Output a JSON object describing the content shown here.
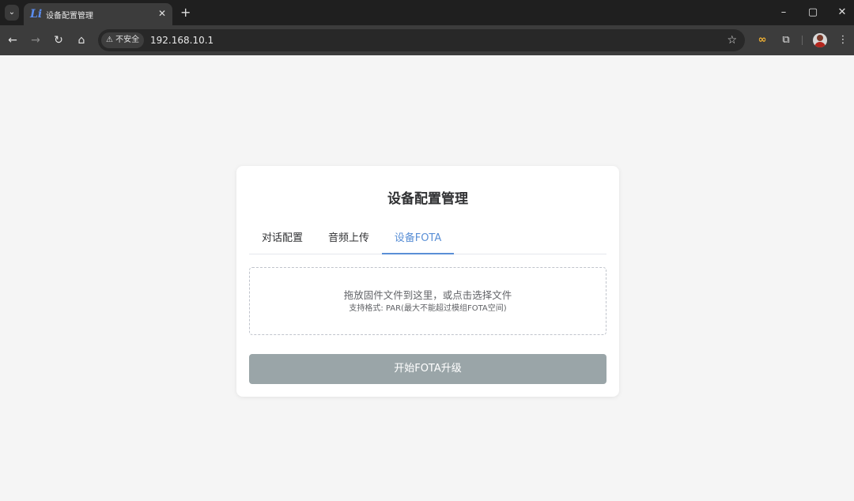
{
  "browser": {
    "tab": {
      "favicon_text": "Li",
      "title": "设备配置管理",
      "close_glyph": "✕"
    },
    "new_tab_glyph": "+",
    "window_controls": {
      "minimize": "–",
      "maximize": "▢",
      "close": "✕"
    },
    "nav": {
      "back": "←",
      "forward": "→",
      "reload": "↻",
      "home": "⌂"
    },
    "address_bar": {
      "security_label": "⚠ 不安全",
      "url": "192.168.10.1",
      "bookmark_glyph": "☆"
    },
    "extensions": {
      "ext1_glyph": "∞",
      "puzzle_glyph": "⧉",
      "menu_glyph": "⋮"
    }
  },
  "card": {
    "title": "设备配置管理",
    "tabs": [
      {
        "label": "对话配置"
      },
      {
        "label": "音频上传"
      },
      {
        "label": "设备FOTA"
      }
    ],
    "active_tab": 2,
    "dropzone": {
      "main_text": "拖放固件文件到这里，或点击选择文件",
      "hint_text": "支持格式: PAR(最大不能超过模组FOTA空间)"
    },
    "start_button_label": "开始FOTA升级"
  },
  "colors": {
    "page_bg": "#f5f5f5",
    "accent": "#5a8fd6",
    "button_disabled": "#9aa5a8",
    "chrome_dark": "#1f1f1f",
    "toolbar": "#3c3c3c"
  },
  "icons": {
    "tab_search": "chevron-down-icon",
    "favicon": "li-logo-icon",
    "warning": "warning-icon",
    "bookmark": "star-icon",
    "extension": "puzzle-icon",
    "profile": "avatar"
  }
}
